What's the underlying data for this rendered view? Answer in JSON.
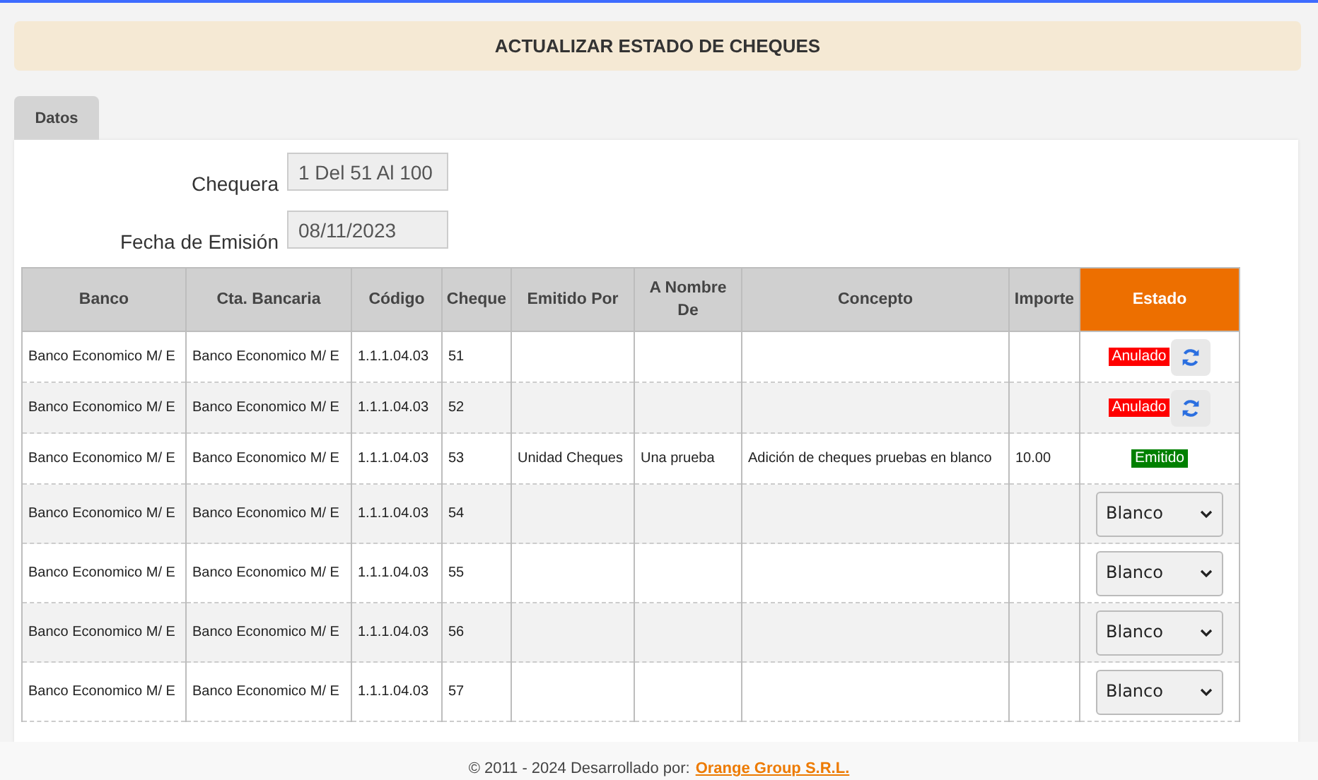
{
  "page_title": "ACTUALIZAR ESTADO DE CHEQUES",
  "tabs": [
    {
      "label": "Datos",
      "selected": true
    }
  ],
  "form": [
    {
      "label": "Chequera",
      "value": "1 Del 51 Al 100"
    },
    {
      "label": "Fecha de Emisión",
      "value": "08/11/2023"
    }
  ],
  "table": {
    "columns": [
      "Banco",
      "Cta. Bancaria",
      "Código",
      "Cheque",
      "Emitido Por",
      "A Nombre De",
      "Concepto",
      "Importe",
      "Estado"
    ],
    "rows": [
      {
        "banco": "Banco Economico M/ E",
        "cuenta": "Banco Economico M/ E",
        "codigo": "1.1.1.04.03",
        "cheque": "51",
        "emitido_por": "",
        "a_nombre_de": "",
        "concepto": "",
        "importe": "",
        "estado": {
          "kind": "badge",
          "label": "Anulado",
          "color": "#ff0000",
          "refresh": true
        }
      },
      {
        "banco": "Banco Economico M/ E",
        "cuenta": "Banco Economico M/ E",
        "codigo": "1.1.1.04.03",
        "cheque": "52",
        "emitido_por": "",
        "a_nombre_de": "",
        "concepto": "",
        "importe": "",
        "estado": {
          "kind": "badge",
          "label": "Anulado",
          "color": "#ff0000",
          "refresh": true
        }
      },
      {
        "banco": "Banco Economico M/ E",
        "cuenta": "Banco Economico M/ E",
        "codigo": "1.1.1.04.03",
        "cheque": "53",
        "emitido_por": "Unidad Cheques",
        "a_nombre_de": "Una prueba",
        "concepto": "Adición de cheques pruebas en blanco",
        "importe": "10.00",
        "estado": {
          "kind": "badge",
          "label": "Emitido",
          "color": "#008000",
          "refresh": false
        }
      },
      {
        "banco": "Banco Economico M/ E",
        "cuenta": "Banco Economico M/ E",
        "codigo": "1.1.1.04.03",
        "cheque": "54",
        "emitido_por": "",
        "a_nombre_de": "",
        "concepto": "",
        "importe": "",
        "estado": {
          "kind": "select",
          "value": "Blanco"
        }
      },
      {
        "banco": "Banco Economico M/ E",
        "cuenta": "Banco Economico M/ E",
        "codigo": "1.1.1.04.03",
        "cheque": "55",
        "emitido_por": "",
        "a_nombre_de": "",
        "concepto": "",
        "importe": "",
        "estado": {
          "kind": "select",
          "value": "Blanco"
        }
      },
      {
        "banco": "Banco Economico M/ E",
        "cuenta": "Banco Economico M/ E",
        "codigo": "1.1.1.04.03",
        "cheque": "56",
        "emitido_por": "",
        "a_nombre_de": "",
        "concepto": "",
        "importe": "",
        "estado": {
          "kind": "select",
          "value": "Blanco"
        }
      },
      {
        "banco": "Banco Economico M/ E",
        "cuenta": "Banco Economico M/ E",
        "codigo": "1.1.1.04.03",
        "cheque": "57",
        "emitido_por": "",
        "a_nombre_de": "",
        "concepto": "",
        "importe": "",
        "estado": {
          "kind": "select",
          "value": "Blanco"
        }
      }
    ]
  },
  "footer": {
    "text": "© 2011 - 2024 Desarrollado por:",
    "link": "Orange Group S.R.L."
  }
}
